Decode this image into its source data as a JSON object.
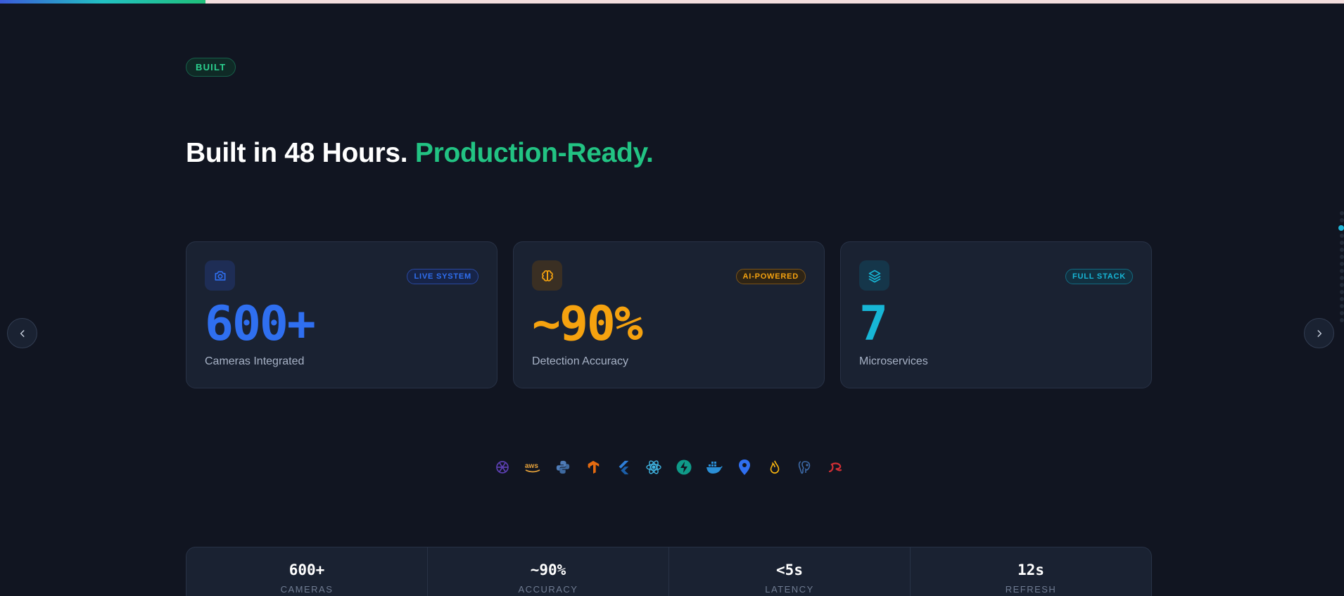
{
  "section": {
    "badge": "BUILT"
  },
  "headline": {
    "part1": "Built in 48 Hours.",
    "part2": "Production-Ready."
  },
  "progress": {
    "fraction": 0.153
  },
  "cards": [
    {
      "icon": "camera-icon",
      "pill": "LIVE SYSTEM",
      "stat": "600+",
      "caption": "Cameras Integrated",
      "accent": "#2f6ff0"
    },
    {
      "icon": "brain-icon",
      "pill": "AI-POWERED",
      "stat": "~90%",
      "caption": "Detection Accuracy",
      "accent": "#f5a20f"
    },
    {
      "icon": "layers-icon",
      "pill": "FULL STACK",
      "stat": "7",
      "caption": "Microservices",
      "accent": "#17b6d6"
    }
  ],
  "tech_icons": [
    "openai-icon",
    "aws-icon",
    "python-icon",
    "tensorflow-icon",
    "flutter-icon",
    "react-icon",
    "fastapi-icon",
    "docker-icon",
    "maps-pin-icon",
    "firebase-icon",
    "postgresql-icon",
    "nestjs-icon"
  ],
  "stats": [
    {
      "value": "600+",
      "label": "CAMERAS"
    },
    {
      "value": "~90%",
      "label": "ACCURACY"
    },
    {
      "value": "<5s",
      "label": "LATENCY"
    },
    {
      "value": "12s",
      "label": "REFRESH"
    }
  ],
  "nav": {
    "prev_icon": "chevron-left-icon",
    "next_icon": "chevron-right-icon"
  },
  "colors": {
    "background": "#111521",
    "green": "#22c383",
    "blue": "#2f6ff0",
    "orange": "#f5a20f",
    "cyan": "#17b6d6"
  }
}
